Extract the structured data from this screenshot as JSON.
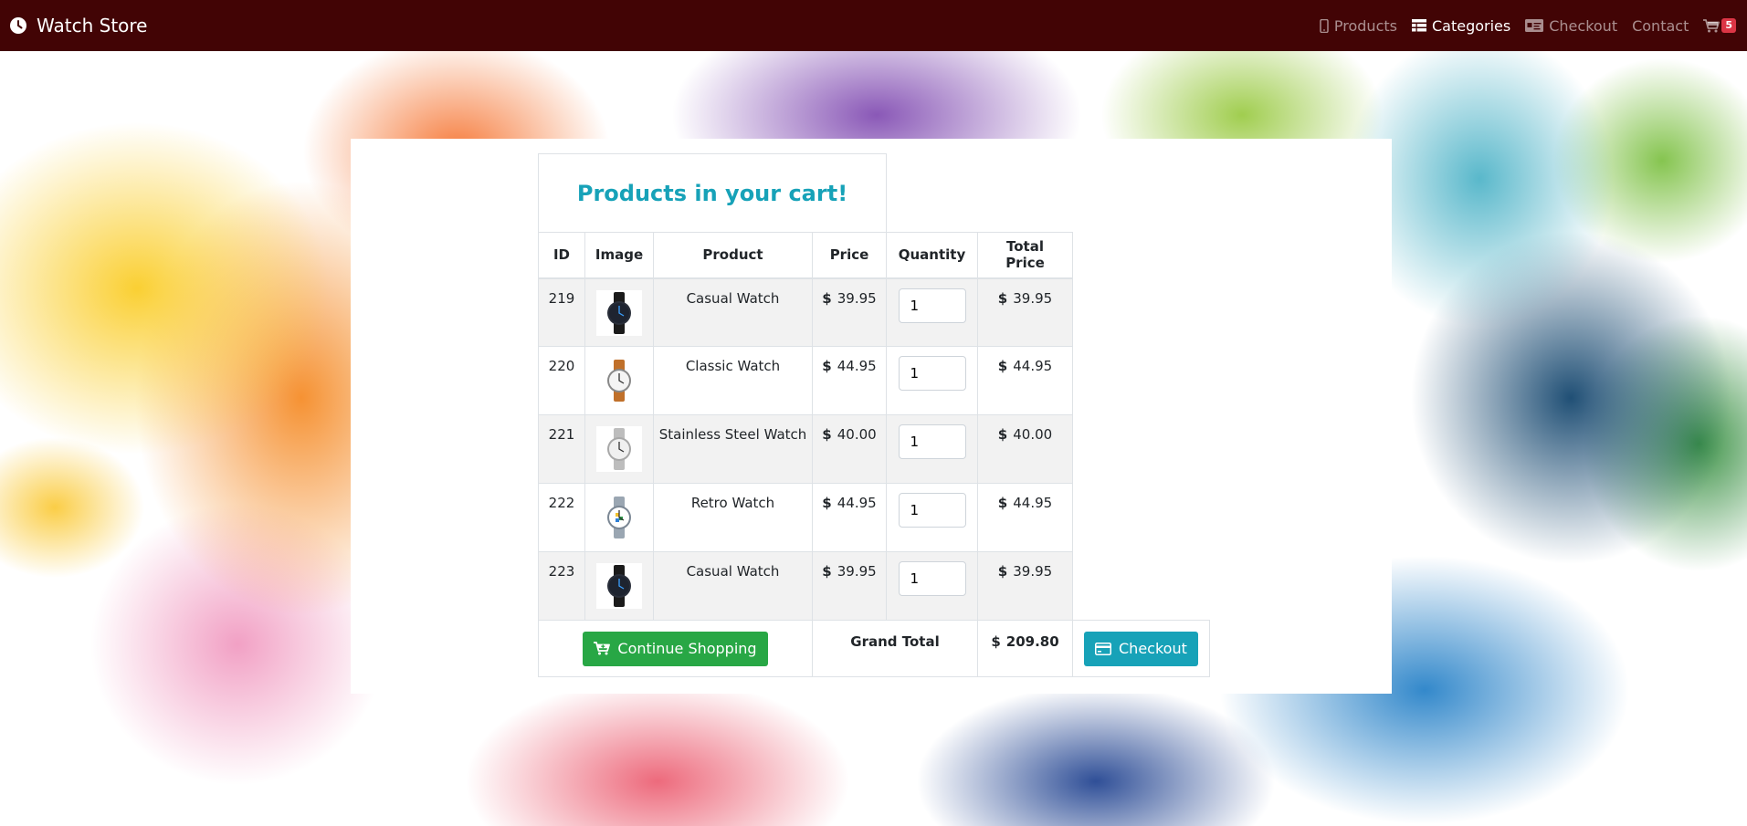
{
  "navbar": {
    "brand": "Watch Store",
    "links": {
      "products": "Products",
      "categories": "Categories",
      "checkout": "Checkout",
      "contact": "Contact"
    },
    "cart_count": "5"
  },
  "cart": {
    "title": "Products in your cart!",
    "headers": {
      "id": "ID",
      "image": "Image",
      "product": "Product",
      "price": "Price",
      "quantity": "Quantity",
      "total": "Total Price"
    },
    "currency_symbol": "$",
    "items": [
      {
        "id": "219",
        "name": "Casual Watch",
        "price": "39.95",
        "qty": "1",
        "total": "39.95",
        "thumb": "black-watch"
      },
      {
        "id": "220",
        "name": "Classic Watch",
        "price": "44.95",
        "qty": "1",
        "total": "44.95",
        "thumb": "brown-watch"
      },
      {
        "id": "221",
        "name": "Stainless Steel Watch",
        "price": "40.00",
        "qty": "1",
        "total": "40.00",
        "thumb": "steel-watch"
      },
      {
        "id": "222",
        "name": "Retro Watch",
        "price": "44.95",
        "qty": "1",
        "total": "44.95",
        "thumb": "retro-watch"
      },
      {
        "id": "223",
        "name": "Casual Watch",
        "price": "39.95",
        "qty": "1",
        "total": "39.95",
        "thumb": "black-watch"
      }
    ],
    "continue_label": "Continue Shopping",
    "grand_total_label": "Grand Total",
    "grand_total": "209.80",
    "checkout_label": "Checkout"
  },
  "colors": {
    "navbar": "#420405",
    "title": "#17a2b8",
    "continue_button": "#28a745",
    "checkout_button": "#17a2b8",
    "badge": "#dc3545"
  }
}
